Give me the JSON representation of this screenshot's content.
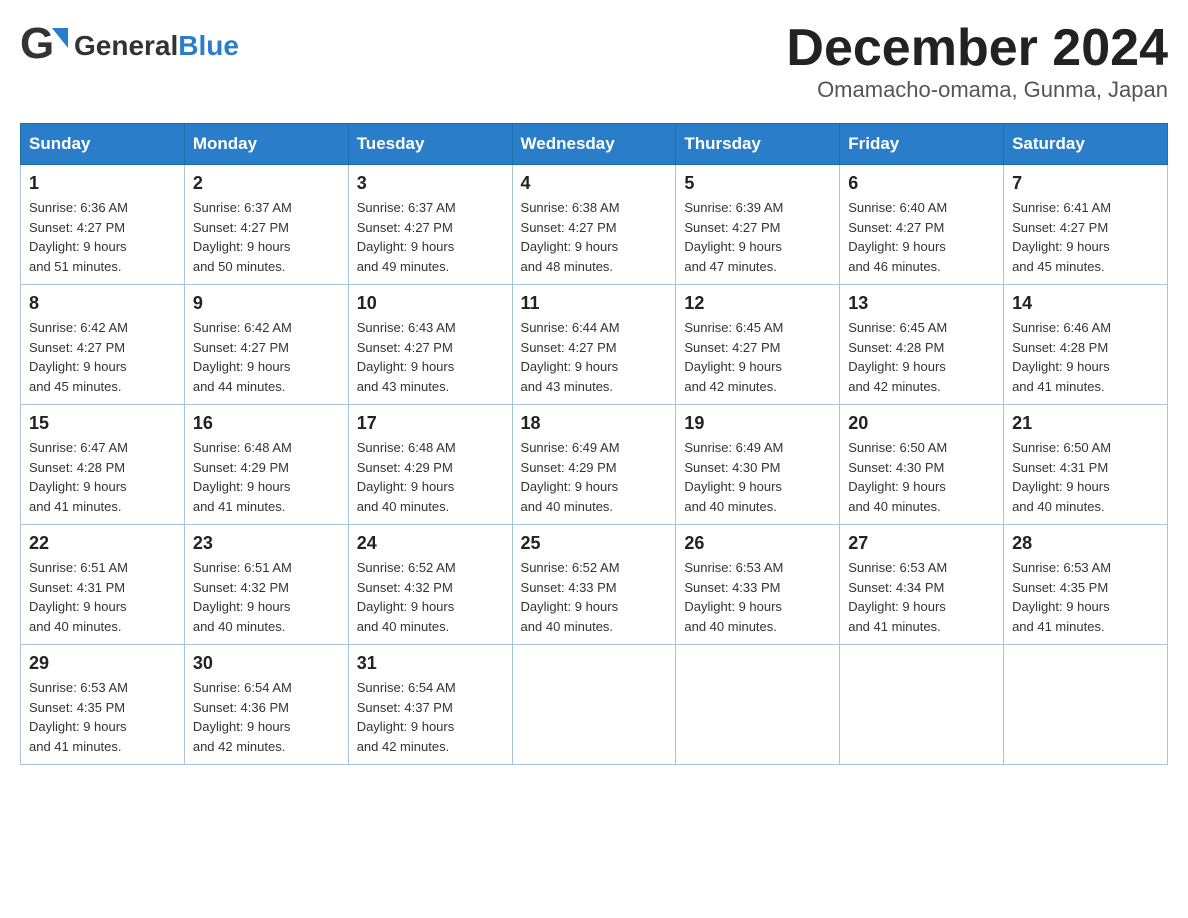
{
  "header": {
    "logo_general": "General",
    "logo_blue": "Blue",
    "month_title": "December 2024",
    "subtitle": "Omamacho-omama, Gunma, Japan"
  },
  "days_of_week": [
    "Sunday",
    "Monday",
    "Tuesday",
    "Wednesday",
    "Thursday",
    "Friday",
    "Saturday"
  ],
  "weeks": [
    [
      {
        "day": "1",
        "sunrise": "6:36 AM",
        "sunset": "4:27 PM",
        "daylight": "9 hours and 51 minutes."
      },
      {
        "day": "2",
        "sunrise": "6:37 AM",
        "sunset": "4:27 PM",
        "daylight": "9 hours and 50 minutes."
      },
      {
        "day": "3",
        "sunrise": "6:37 AM",
        "sunset": "4:27 PM",
        "daylight": "9 hours and 49 minutes."
      },
      {
        "day": "4",
        "sunrise": "6:38 AM",
        "sunset": "4:27 PM",
        "daylight": "9 hours and 48 minutes."
      },
      {
        "day": "5",
        "sunrise": "6:39 AM",
        "sunset": "4:27 PM",
        "daylight": "9 hours and 47 minutes."
      },
      {
        "day": "6",
        "sunrise": "6:40 AM",
        "sunset": "4:27 PM",
        "daylight": "9 hours and 46 minutes."
      },
      {
        "day": "7",
        "sunrise": "6:41 AM",
        "sunset": "4:27 PM",
        "daylight": "9 hours and 45 minutes."
      }
    ],
    [
      {
        "day": "8",
        "sunrise": "6:42 AM",
        "sunset": "4:27 PM",
        "daylight": "9 hours and 45 minutes."
      },
      {
        "day": "9",
        "sunrise": "6:42 AM",
        "sunset": "4:27 PM",
        "daylight": "9 hours and 44 minutes."
      },
      {
        "day": "10",
        "sunrise": "6:43 AM",
        "sunset": "4:27 PM",
        "daylight": "9 hours and 43 minutes."
      },
      {
        "day": "11",
        "sunrise": "6:44 AM",
        "sunset": "4:27 PM",
        "daylight": "9 hours and 43 minutes."
      },
      {
        "day": "12",
        "sunrise": "6:45 AM",
        "sunset": "4:27 PM",
        "daylight": "9 hours and 42 minutes."
      },
      {
        "day": "13",
        "sunrise": "6:45 AM",
        "sunset": "4:28 PM",
        "daylight": "9 hours and 42 minutes."
      },
      {
        "day": "14",
        "sunrise": "6:46 AM",
        "sunset": "4:28 PM",
        "daylight": "9 hours and 41 minutes."
      }
    ],
    [
      {
        "day": "15",
        "sunrise": "6:47 AM",
        "sunset": "4:28 PM",
        "daylight": "9 hours and 41 minutes."
      },
      {
        "day": "16",
        "sunrise": "6:48 AM",
        "sunset": "4:29 PM",
        "daylight": "9 hours and 41 minutes."
      },
      {
        "day": "17",
        "sunrise": "6:48 AM",
        "sunset": "4:29 PM",
        "daylight": "9 hours and 40 minutes."
      },
      {
        "day": "18",
        "sunrise": "6:49 AM",
        "sunset": "4:29 PM",
        "daylight": "9 hours and 40 minutes."
      },
      {
        "day": "19",
        "sunrise": "6:49 AM",
        "sunset": "4:30 PM",
        "daylight": "9 hours and 40 minutes."
      },
      {
        "day": "20",
        "sunrise": "6:50 AM",
        "sunset": "4:30 PM",
        "daylight": "9 hours and 40 minutes."
      },
      {
        "day": "21",
        "sunrise": "6:50 AM",
        "sunset": "4:31 PM",
        "daylight": "9 hours and 40 minutes."
      }
    ],
    [
      {
        "day": "22",
        "sunrise": "6:51 AM",
        "sunset": "4:31 PM",
        "daylight": "9 hours and 40 minutes."
      },
      {
        "day": "23",
        "sunrise": "6:51 AM",
        "sunset": "4:32 PM",
        "daylight": "9 hours and 40 minutes."
      },
      {
        "day": "24",
        "sunrise": "6:52 AM",
        "sunset": "4:32 PM",
        "daylight": "9 hours and 40 minutes."
      },
      {
        "day": "25",
        "sunrise": "6:52 AM",
        "sunset": "4:33 PM",
        "daylight": "9 hours and 40 minutes."
      },
      {
        "day": "26",
        "sunrise": "6:53 AM",
        "sunset": "4:33 PM",
        "daylight": "9 hours and 40 minutes."
      },
      {
        "day": "27",
        "sunrise": "6:53 AM",
        "sunset": "4:34 PM",
        "daylight": "9 hours and 41 minutes."
      },
      {
        "day": "28",
        "sunrise": "6:53 AM",
        "sunset": "4:35 PM",
        "daylight": "9 hours and 41 minutes."
      }
    ],
    [
      {
        "day": "29",
        "sunrise": "6:53 AM",
        "sunset": "4:35 PM",
        "daylight": "9 hours and 41 minutes."
      },
      {
        "day": "30",
        "sunrise": "6:54 AM",
        "sunset": "4:36 PM",
        "daylight": "9 hours and 42 minutes."
      },
      {
        "day": "31",
        "sunrise": "6:54 AM",
        "sunset": "4:37 PM",
        "daylight": "9 hours and 42 minutes."
      },
      null,
      null,
      null,
      null
    ]
  ],
  "labels": {
    "sunrise": "Sunrise:",
    "sunset": "Sunset:",
    "daylight": "Daylight:"
  }
}
